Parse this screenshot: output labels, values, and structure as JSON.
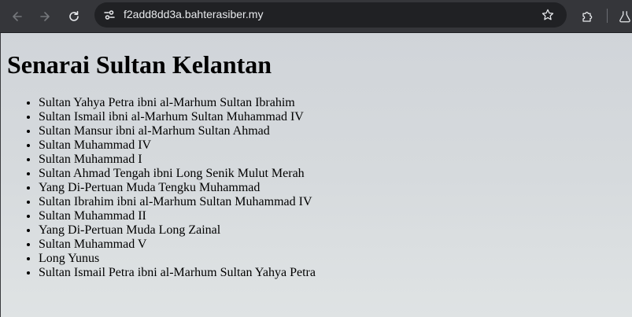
{
  "browser": {
    "url": "f2add8dd3a.bahterasiber.my",
    "icons": {
      "back": "arrow-left-icon",
      "forward": "arrow-right-icon",
      "reload": "reload-icon",
      "site_info": "tune-icon",
      "bookmark": "star-icon",
      "extensions": "puzzle-icon",
      "labs": "flask-icon"
    },
    "colors": {
      "toolbar": "#35363a",
      "omnibox": "#202124",
      "url_text": "#e8eaed"
    }
  },
  "page": {
    "title": "Senarai Sultan Kelantan",
    "items": [
      "Sultan Yahya Petra ibni al-Marhum Sultan Ibrahim",
      "Sultan Ismail ibni al-Marhum Sultan Muhammad IV",
      "Sultan Mansur ibni al-Marhum Sultan Ahmad",
      "Sultan Muhammad IV",
      "Sultan Muhammad I",
      "Sultan Ahmad Tengah ibni Long Senik Mulut Merah",
      "Yang Di-Pertuan Muda Tengku Muhammad",
      "Sultan Ibrahim ibni al-Marhum Sultan Muhammad IV",
      "Sultan Muhammad II",
      "Yang Di-Pertuan Muda Long Zainal",
      "Sultan Muhammad V",
      "Long Yunus",
      "Sultan Ismail Petra ibni al-Marhum Sultan Yahya Petra"
    ],
    "colors": {
      "background": "#d2d6da",
      "text": "#000000"
    }
  }
}
